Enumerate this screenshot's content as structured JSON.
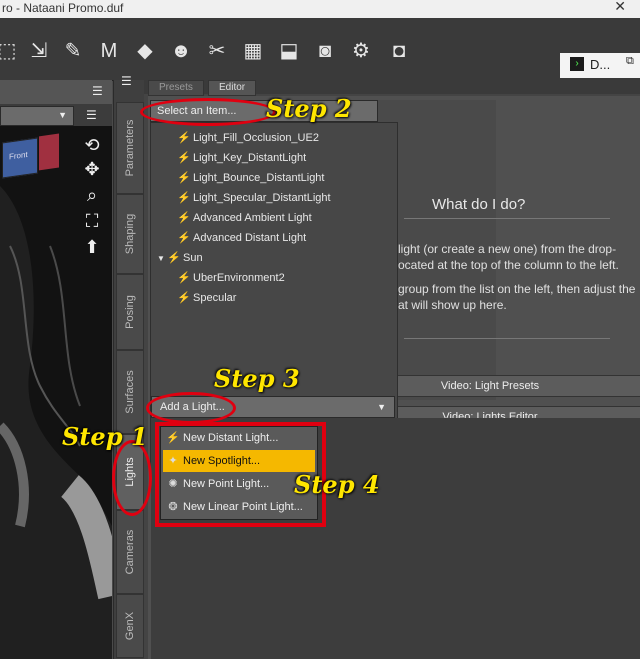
{
  "window": {
    "title": "ro - Nataani Promo.duf",
    "close_glyph": "✕"
  },
  "toolbar": {
    "tab_label": "D..."
  },
  "viewport": {
    "select_arrow": "▼",
    "cube_face": "Front"
  },
  "side_tabs": [
    "Parameters",
    "Shaping",
    "Posing",
    "Surfaces",
    "Lights",
    "Cameras",
    "GenX"
  ],
  "pane_tabs": [
    "Presets",
    "Editor"
  ],
  "select_item": {
    "label": "Select an Item..."
  },
  "items": [
    {
      "label": "Light_Fill_Occlusion_UE2",
      "indent": 0
    },
    {
      "label": "Light_Key_DistantLight",
      "indent": 0
    },
    {
      "label": "Light_Bounce_DistantLight",
      "indent": 0
    },
    {
      "label": "Light_Specular_DistantLight",
      "indent": 0
    },
    {
      "label": "Advanced Ambient Light",
      "indent": 0
    },
    {
      "label": "Advanced Distant Light",
      "indent": 0
    },
    {
      "label": "Sun",
      "indent": 0,
      "group": true
    },
    {
      "label": "UberEnvironment2",
      "indent": 1
    },
    {
      "label": "Specular",
      "indent": 1
    }
  ],
  "help": {
    "title": "What do I do?",
    "line1": "light (or create a new one) from the drop-",
    "line2": "ocated at the top of the column to the left.",
    "line3": "group from the list on the left, then adjust the",
    "line4": "at will show up here."
  },
  "video_bars": [
    "Video: Light Presets",
    "Video: Lights Editor"
  ],
  "add_light": {
    "label": "Add a Light...",
    "arrow": "▼"
  },
  "menu": [
    {
      "label": "New Distant Light...",
      "selected": false
    },
    {
      "label": "New Spotlight...",
      "selected": true
    },
    {
      "label": "New Point Light...",
      "selected": false
    },
    {
      "label": "New Linear Point Light...",
      "selected": false
    }
  ],
  "steps": [
    "Step 1",
    "Step 2",
    "Step 3",
    "Step 4"
  ],
  "colors": {
    "annotation_text": "#ffe600",
    "annotation_outline": "#e00010",
    "selected_menu": "#f5b800"
  }
}
